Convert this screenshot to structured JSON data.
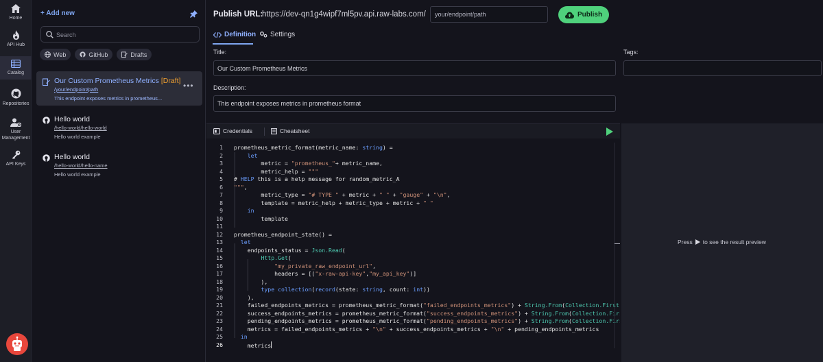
{
  "nav": {
    "items": [
      {
        "label": "Home",
        "icon": "home-icon"
      },
      {
        "label": "API Hub",
        "icon": "flame-icon"
      },
      {
        "label": "Catalog",
        "icon": "catalog-icon"
      },
      {
        "label": "Repositories",
        "icon": "github-icon"
      },
      {
        "label": "User Management",
        "label_line1": "User",
        "label_line2": "Management",
        "icon": "user-management-icon"
      },
      {
        "label": "API Keys",
        "icon": "key-icon"
      }
    ],
    "active": "Catalog"
  },
  "sidebar": {
    "add_new": "+ Add new",
    "search_placeholder": "Search",
    "filters": [
      {
        "label": "Web",
        "icon": "globe-icon"
      },
      {
        "label": "GitHub",
        "icon": "github-icon"
      },
      {
        "label": "Drafts",
        "icon": "draft-icon"
      }
    ],
    "endpoints": [
      {
        "title": "Our Custom Prometheus Metrics",
        "badge": "[Draft]",
        "path": "/your/endpoint/path",
        "description": "This endpoint exposes metrics in prometheus...",
        "selected": true
      },
      {
        "title": "Hello world",
        "path": "/hello-world/hello-world",
        "description": "Hello world example",
        "selected": false
      },
      {
        "title": "Hello world",
        "path": "/hello-world/hello-name",
        "description": "Hello world example",
        "selected": false
      }
    ]
  },
  "publish": {
    "label": "Publish URL:",
    "base_url": "https://dev-qn1g4wipf7ml5pv.api.raw-labs.com/",
    "path_value": "your/endpoint/path",
    "button": "Publish"
  },
  "tabs": {
    "definition": "Definition",
    "settings": "Settings",
    "active": "Definition"
  },
  "form": {
    "title_label": "Title:",
    "title_value": "Our Custom Prometheus Metrics",
    "tags_label": "Tags:",
    "tags_value": "",
    "description_label": "Description:",
    "description_value": "This endpoint exposes metrics in prometheus format"
  },
  "editor": {
    "credentials": "Credentials",
    "cheatsheet": "Cheatsheet",
    "line_numbers": [
      "1",
      "2",
      "3",
      "4",
      "5",
      "6",
      "7",
      "8",
      "9",
      "10",
      "11",
      "12",
      "13",
      "14",
      "15",
      "16",
      "17",
      "18",
      "19",
      "20",
      "21",
      "22",
      "23",
      "24",
      "25",
      "26"
    ],
    "current_line": "26",
    "code_lines": [
      "prometheus_metric_format(metric_name: string) =",
      "    let",
      "        metric = \"prometheus_\"+ metric_name,",
      "        metric_help = \"\"\"",
      "# HELP this is a help message for random_metric_A",
      "\"\"\",",
      "        metric_type = \"# TYPE \" + metric + \" \" + \"gauge\" + \"\\n\",",
      "        template = metric_help + metric_type + metric + \" \"",
      "    in",
      "        template",
      "",
      "prometheus_endpoint_state() =",
      "  let",
      "    endpoints_status = Json.Read(",
      "        Http.Get(",
      "            \"my_private_raw_endpoint_url\",",
      "            headers = [(\"x-raw-api-key\",\"my_api_key\")]",
      "        ),",
      "        type collection(record(state: string, count: int))",
      "    ),",
      "    failed_endpoints_metrics = prometheus_metric_format(\"failed_endpoints_metrics\") + String.From(Collection.First",
      "    success_endpoints_metrics = prometheus_metric_format(\"success_endpoints_metrics\") + String.From(Collection.Firs",
      "    pending_endpoints_metrics = prometheus_metric_format(\"pending_endpoints_metrics\") + String.From(Collection.Firs",
      "    metrics = failed_endpoints_metrics + \"\\n\" + success_endpoints_metrics + \"\\n\" + pending_endpoints_metrics",
      "  in",
      "    metrics"
    ]
  },
  "preview": {
    "press": "Press",
    "hint": "to see the result preview"
  },
  "colors": {
    "accent": "#7fa6f0",
    "publish_green": "#4fd17c",
    "draft_orange": "#f0a030",
    "background": "#14141c"
  }
}
